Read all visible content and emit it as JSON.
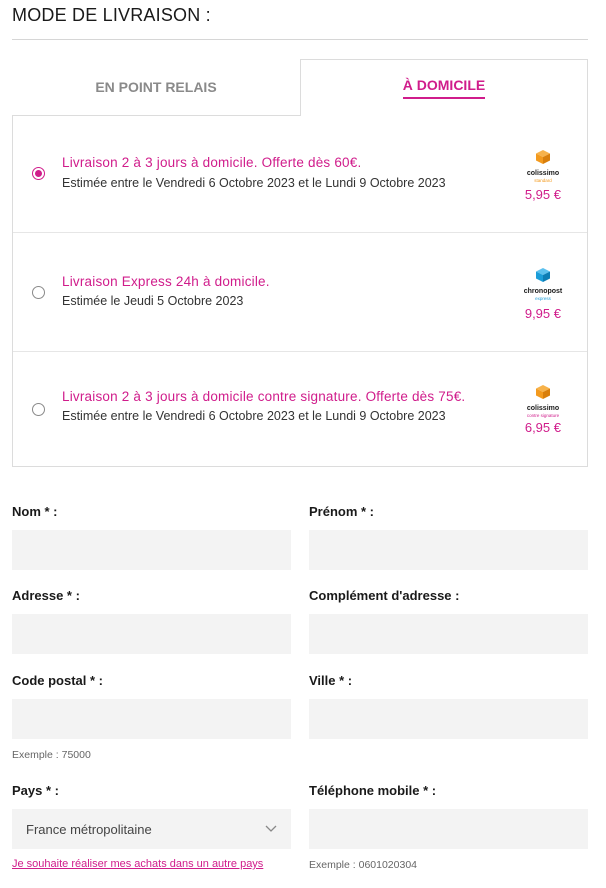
{
  "section_title": "MODE DE LIVRAISON :",
  "tabs": [
    {
      "label": "EN POINT RELAIS"
    },
    {
      "label": "À DOMICILE"
    }
  ],
  "options": [
    {
      "title": "Livraison 2 à 3 jours à domicile. Offerte dès 60€.",
      "subtitle": "Estimée entre le Vendredi 6 Octobre 2023 et le Lundi 9 Octobre 2023",
      "logo_name": "colissimo",
      "logo_sub": "standard",
      "price": "5,95 €",
      "selected": true
    },
    {
      "title": "Livraison Express 24h à domicile.",
      "subtitle": "Estimée le Jeudi 5 Octobre 2023",
      "logo_name": "chronopost",
      "logo_sub": "express",
      "price": "9,95 €",
      "selected": false
    },
    {
      "title": "Livraison 2 à 3 jours à domicile contre signature. Offerte dès 75€.",
      "subtitle": "Estimée entre le Vendredi 6 Octobre 2023 et le Lundi 9 Octobre 2023",
      "logo_name": "colissimo",
      "logo_sub": "contre signature",
      "price": "6,95 €",
      "selected": false
    }
  ],
  "form": {
    "nom_label": "Nom * :",
    "prenom_label": "Prénom * :",
    "adresse_label": "Adresse * :",
    "complement_label": "Complément d'adresse :",
    "code_postal_label": "Code postal * :",
    "code_postal_hint": "Exemple : 75000",
    "ville_label": "Ville * :",
    "pays_label": "Pays * :",
    "pays_value": "France métropolitaine",
    "pays_link": "Je souhaite réaliser mes achats dans un autre pays",
    "telephone_label": "Téléphone mobile * :",
    "telephone_hint": "Exemple : 0601020304"
  },
  "colors": {
    "accent": "#d01c8b",
    "colissimo": "#f39a1e",
    "chronopost": "#1b9dd9"
  }
}
